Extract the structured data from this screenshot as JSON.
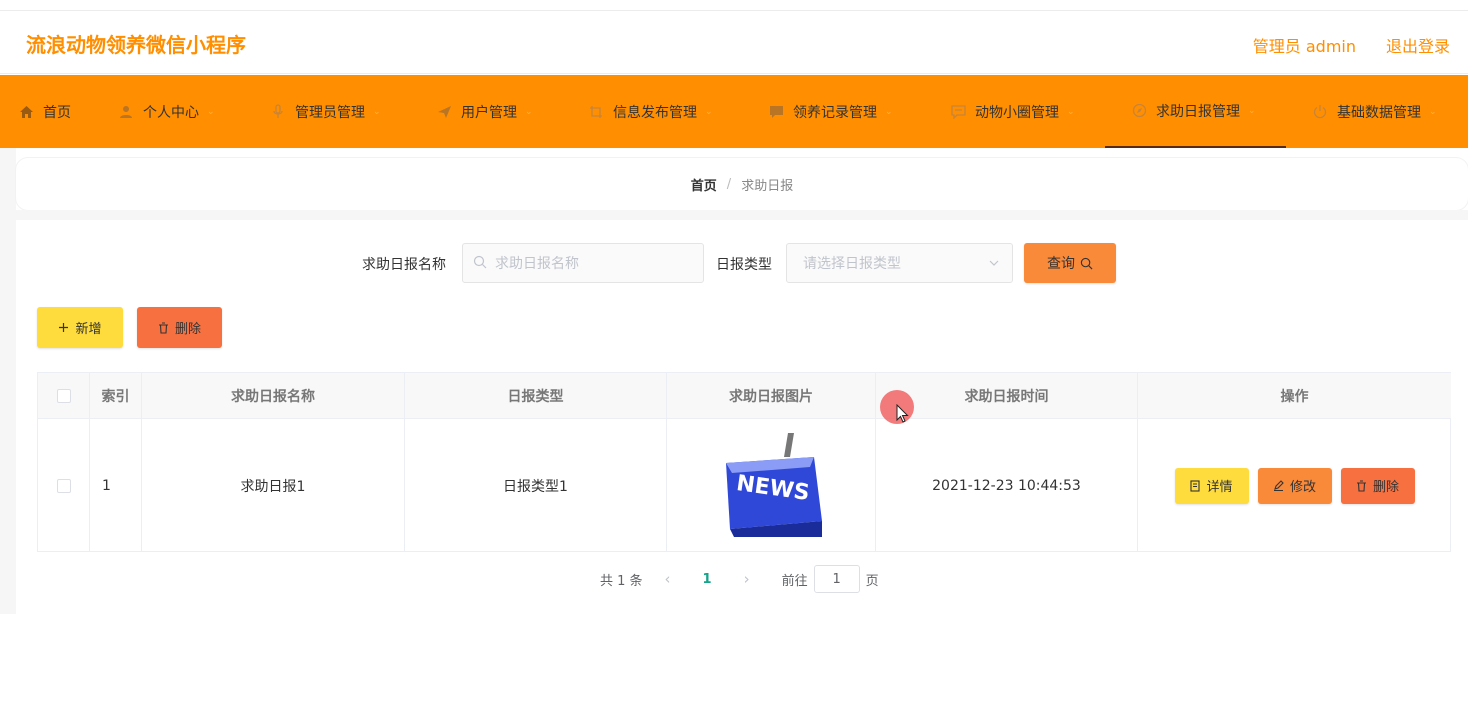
{
  "header": {
    "app_title": "流浪动物领养微信小程序",
    "user_label": "管理员 admin",
    "logout": "退出登录"
  },
  "nav": {
    "items": [
      {
        "label": "首页",
        "icon": "home-icon"
      },
      {
        "label": "个人中心",
        "icon": "user-icon"
      },
      {
        "label": "管理员管理",
        "icon": "microphone-icon"
      },
      {
        "label": "用户管理",
        "icon": "send-icon"
      },
      {
        "label": "信息发布管理",
        "icon": "crop-icon"
      },
      {
        "label": "领养记录管理",
        "icon": "chat-icon"
      },
      {
        "label": "动物小圈管理",
        "icon": "message-icon"
      },
      {
        "label": "求助日报管理",
        "icon": "compass-icon"
      },
      {
        "label": "基础数据管理",
        "icon": "power-icon"
      }
    ],
    "active_index": 7
  },
  "breadcrumb": {
    "home": "首页",
    "separator": "/",
    "current": "求助日报"
  },
  "search": {
    "name_label": "求助日报名称",
    "name_placeholder": "求助日报名称",
    "type_label": "日报类型",
    "type_placeholder": "请选择日报类型",
    "query_button": "查询"
  },
  "actions": {
    "add": "新增",
    "delete": "删除"
  },
  "table": {
    "headers": [
      "索引",
      "求助日报名称",
      "日报类型",
      "求助日报图片",
      "求助日报时间",
      "操作"
    ],
    "rows": [
      {
        "index": "1",
        "name": "求助日报1",
        "type": "日报类型1",
        "image_text": "NEWS",
        "time": "2021-12-23 10:44:53",
        "ops": {
          "detail": "详情",
          "edit": "修改",
          "delete": "删除"
        }
      }
    ]
  },
  "pagination": {
    "total": "共 1 条",
    "current_page": "1",
    "goto_label": "前往",
    "goto_value": "1",
    "page_suffix": "页"
  },
  "colors": {
    "accent": "#ff8f00",
    "query_button": "#f98a3a",
    "add_button": "#fedc3d",
    "delete_button": "#f7703f",
    "edit_button": "#f98a3a",
    "detail_button": "#fedc3d",
    "pager_active": "#15a38a"
  }
}
